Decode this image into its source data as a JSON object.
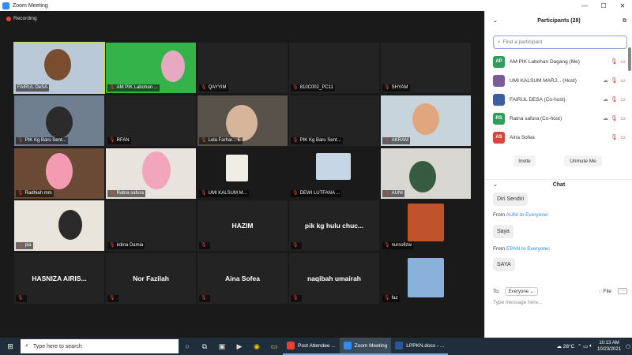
{
  "window": {
    "title": "Zoom Meeting",
    "minimize": "—",
    "maximize": "☐",
    "close": "✕"
  },
  "recording": {
    "label": "Recording"
  },
  "tiles": [
    {
      "label": "FAIRUL DeSA",
      "muted": false,
      "center": ""
    },
    {
      "label": "AM PIK Labohan ...",
      "muted": true,
      "center": ""
    },
    {
      "label": "QAYYIM",
      "muted": true,
      "center": ""
    },
    {
      "label": "810C002_PC11",
      "muted": true,
      "center": ""
    },
    {
      "label": "SHYAM",
      "muted": true,
      "center": ""
    },
    {
      "label": "PIK Kg Baru Sent...",
      "muted": true,
      "center": ""
    },
    {
      "label": "RFAN",
      "muted": true,
      "center": ""
    },
    {
      "label": "Lela Farhar... E",
      "muted": true,
      "center": ""
    },
    {
      "label": "PIK Kg Baru Sent...",
      "muted": true,
      "center": ""
    },
    {
      "label": "AKRAM",
      "muted": true,
      "center": ""
    },
    {
      "label": "Radhiah mm",
      "muted": true,
      "center": ""
    },
    {
      "label": "Ratna safura",
      "muted": true,
      "center": ""
    },
    {
      "label": "UMI KALSUM M...",
      "muted": true,
      "center": ""
    },
    {
      "label": "DEWI LUTFANA ...",
      "muted": true,
      "center": ""
    },
    {
      "label": "AUNI",
      "muted": true,
      "center": ""
    },
    {
      "label": "pia",
      "muted": true,
      "center": ""
    },
    {
      "label": "irdina Damia",
      "muted": true,
      "center": ""
    },
    {
      "label": "",
      "muted": true,
      "center": "HAZIM"
    },
    {
      "label": "",
      "muted": true,
      "center": "pik kg hulu chuc..."
    },
    {
      "label": "nursofizw",
      "muted": true,
      "center": ""
    },
    {
      "label": "",
      "muted": true,
      "center": "HASNIZA AIRIS..."
    },
    {
      "label": "",
      "muted": true,
      "center": "Nor Fazilah"
    },
    {
      "label": "",
      "muted": true,
      "center": "Aina Sofea"
    },
    {
      "label": "",
      "muted": true,
      "center": "naqibah umairah"
    },
    {
      "label": "faz",
      "muted": true,
      "center": ""
    }
  ],
  "participants": {
    "title": "Participants (28)",
    "search_placeholder": "Find a participant",
    "list": [
      {
        "initials": "AP",
        "color": "#2e9e5b",
        "name": "AM PIK Labohan Dagang (Me)"
      },
      {
        "initials": "",
        "color": "#7a5b9a",
        "name": "UMI KALSUM MARJ...  (Host)"
      },
      {
        "initials": "",
        "color": "#3b5f9a",
        "name": "FAIRUL DESA (Co-host)"
      },
      {
        "initials": "RS",
        "color": "#2e9e5b",
        "name": "Ratna safura (Co-host)"
      },
      {
        "initials": "AS",
        "color": "#d9453b",
        "name": "Aina Sofea"
      }
    ],
    "invite": "Invite",
    "unmute_me": "Unmute Me"
  },
  "chat": {
    "title": "Chat",
    "messages": [
      {
        "meta": "",
        "text": "Diri Sendiri"
      },
      {
        "meta_from": "From ",
        "meta_who": "AUNI to Everyone",
        "meta": ":",
        "text": "Saya"
      },
      {
        "meta_from": "From ",
        "meta_who": "EPAN to Everyone",
        "meta": ":",
        "text": "SAYA"
      }
    ],
    "to_label": "To:",
    "to_value": "Everyone",
    "file_label": "File",
    "more": "···",
    "input_placeholder": "Type message here..."
  },
  "taskbar": {
    "search_placeholder": "Type here to search",
    "apps": [
      {
        "label": "Post Attendee ...",
        "color": "#e94235",
        "active": false
      },
      {
        "label": "Zoom Meeting",
        "color": "#2d8cff",
        "active": true
      },
      {
        "label": "LPPKN.docx - ...",
        "color": "#2b579a",
        "active": false
      }
    ],
    "weather": "28°C",
    "time": "10:13 AM",
    "date": "10/23/2021"
  }
}
